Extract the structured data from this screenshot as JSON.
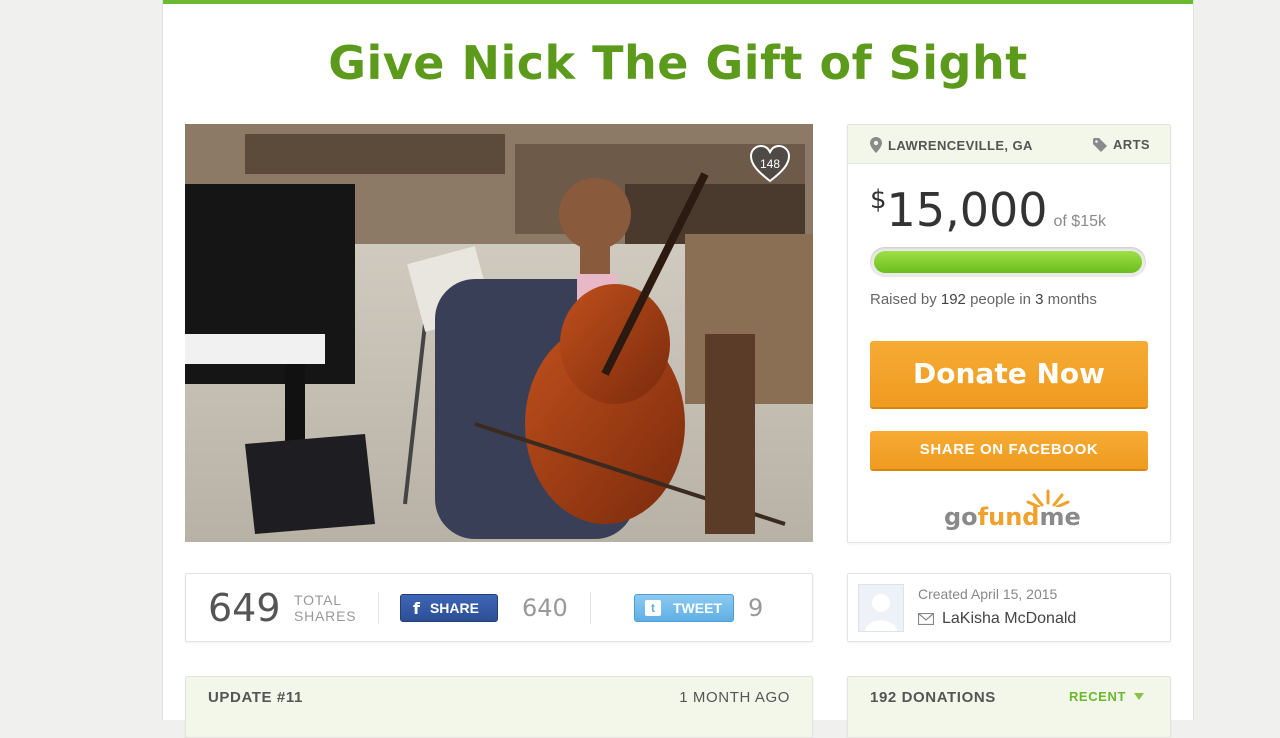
{
  "campaign": {
    "title": "Give Nick The Gift of Sight",
    "likes": "148"
  },
  "sidebar": {
    "location": "LAWRENCEVILLE, GA",
    "category": "ARTS",
    "currency": "$",
    "raised": "15,000",
    "goal": "of $15k",
    "progress_fraction": 1.0,
    "raised_by_prefix": "Raised by",
    "people_count": "192",
    "people_word": "people in",
    "months_count": "3",
    "months_word": "months",
    "donate_label": "Donate Now",
    "facebook_label": "SHARE ON FACEBOOK",
    "logo_go": "go",
    "logo_fund": "fund",
    "logo_me": "me"
  },
  "shares": {
    "total": "649",
    "total_label_1": "TOTAL",
    "total_label_2": "SHARES",
    "facebook_label": "SHARE",
    "facebook_count": "640",
    "twitter_label": "TWEET",
    "twitter_count": "9"
  },
  "creator": {
    "created": "Created April 15, 2015",
    "name": "LaKisha McDonald"
  },
  "update_bar": {
    "label": "UPDATE #11",
    "time": "1 MONTH AGO"
  },
  "donations_bar": {
    "label": "192 DONATIONS",
    "sort": "RECENT"
  },
  "colors": {
    "brand_green": "#5c9a1b",
    "accent_orange": "#f1a12b",
    "facebook_blue": "#3b5998",
    "twitter_blue": "#6bb7e8"
  }
}
